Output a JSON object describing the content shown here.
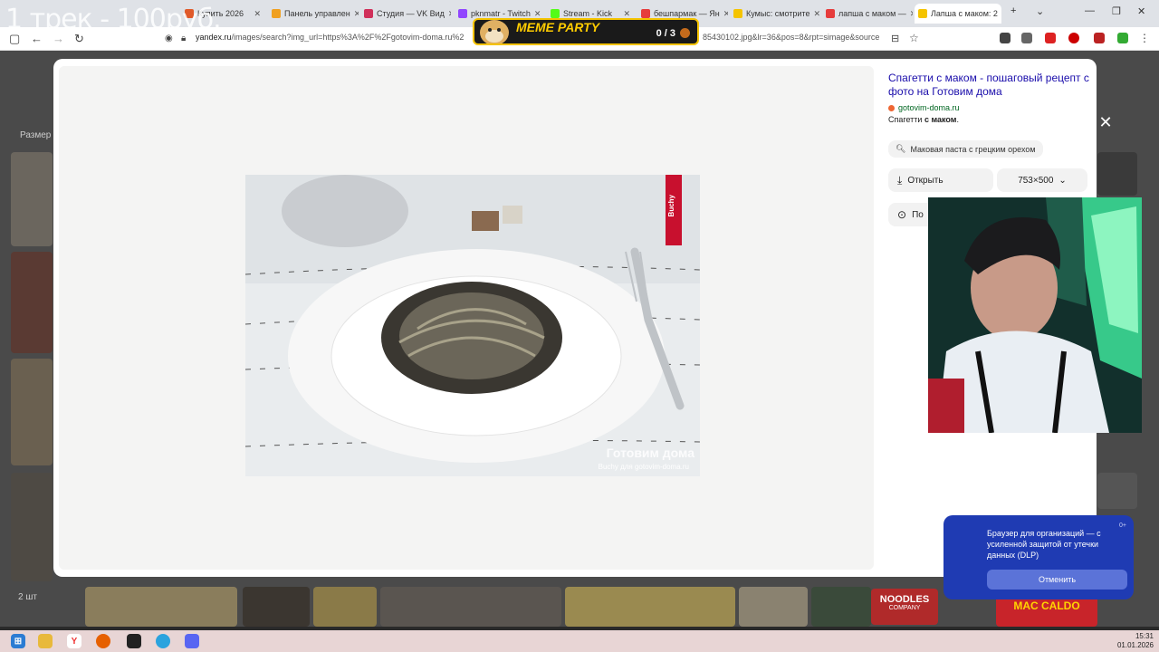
{
  "tabs": [
    {
      "label": "Купить 2026",
      "color": "#e05a2a"
    },
    {
      "label": "Панель управлен",
      "color": "#f0a020"
    },
    {
      "label": "Студия — VK Вид",
      "color": "#d0305a"
    },
    {
      "label": "pknmatr - Twitch",
      "color": "#9146ff"
    },
    {
      "label": "Stream - Kick",
      "color": "#53fc18"
    },
    {
      "label": "бешпармак — Ян",
      "color": "#e63c3c"
    },
    {
      "label": "Кумыс: смотрите",
      "color": "#f5c400"
    },
    {
      "label": "лапша с маком —",
      "color": "#e63c3c"
    },
    {
      "label": "Лапша с маком: 2",
      "color": "#f5c400"
    }
  ],
  "address": {
    "host": "yandex.ru",
    "path": "/images/search?img_url=https%3A%2F%2Fgotovim-doma.ru%2",
    "tail": "85430102.jpg&lr=36&pos=8&rpt=simage&source"
  },
  "overlay": {
    "title": "1 трек - 100руб.",
    "meme_label": "MEME PARTY",
    "meme_score": "0 / 3"
  },
  "background": {
    "size_label": "Размер",
    "count_label": "2 шт",
    "noodles_label": "NOODLES",
    "noodles_sub": "COMPANY",
    "mac_label": "MAC CALDO"
  },
  "viewer": {
    "ribbon": "Buchy",
    "watermark": "Готовим дома",
    "credit": "Buchy для gotovim-doma.ru"
  },
  "side": {
    "title": "Спагетти с маком - пошаговый рецепт с фото на Готовим дома",
    "source": "gotovim-doma.ru",
    "description_prefix": "Спагетти",
    "description_bold": "с маком",
    "description_suffix": ".",
    "chip": "Маковая паста с грецким орехом",
    "open_label": "Открыть",
    "size_label": "753×500",
    "more_label": "По"
  },
  "notification": {
    "age": "0+",
    "text": "Браузер для организаций — с усиленной защитой от утечки данных (DLP)",
    "cancel": "Отменить"
  },
  "clock": {
    "time": "15:31",
    "date": "01.01.2026"
  }
}
